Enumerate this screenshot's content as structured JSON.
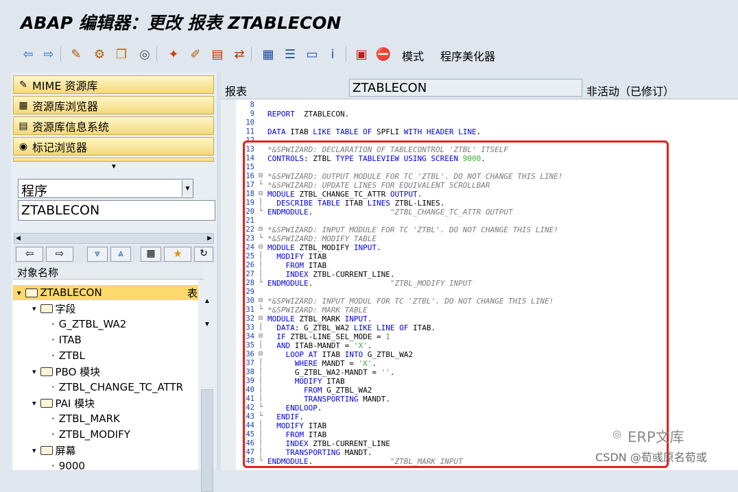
{
  "window": {
    "title": "ABAP 编辑器：更改 报表 ZTABLECON"
  },
  "toolbar": {
    "buttons": [
      {
        "name": "back-icon",
        "glyph": "⇦"
      },
      {
        "name": "forward-icon",
        "glyph": "⇨"
      },
      {
        "name": "display-change-icon",
        "glyph": "✎"
      },
      {
        "name": "active-inactive-icon",
        "glyph": "⚙"
      },
      {
        "name": "other-object-icon",
        "glyph": "❐"
      },
      {
        "name": "check-icon",
        "glyph": "◎"
      },
      {
        "name": "activate-icon",
        "glyph": "✦"
      },
      {
        "name": "test-icon",
        "glyph": "✐"
      },
      {
        "name": "where-used-icon",
        "glyph": "▤"
      },
      {
        "name": "navigate-icon",
        "glyph": "⇄"
      },
      {
        "name": "object-list-icon",
        "glyph": "▦"
      },
      {
        "name": "pretty-printer-icon",
        "glyph": "☰"
      },
      {
        "name": "display-object-list-icon",
        "glyph": "▭"
      },
      {
        "name": "info-icon",
        "glyph": "i"
      },
      {
        "name": "set-breakpoint-icon",
        "glyph": "▣"
      },
      {
        "name": "stop-breakpoint-icon",
        "glyph": "⛔"
      }
    ],
    "pattern_label": "模式",
    "pretty_printer_label": "程序美化器"
  },
  "nav": {
    "items": [
      {
        "label": "MIME 资源库",
        "icon": "mime-repo-icon",
        "glyph": "✎"
      },
      {
        "label": "资源库浏览器",
        "icon": "repo-browser-icon",
        "glyph": "▦"
      },
      {
        "label": "资源库信息系统",
        "icon": "repo-info-icon",
        "glyph": "▤"
      },
      {
        "label": "标记浏览器",
        "icon": "tag-browser-icon",
        "glyph": "◉"
      }
    ],
    "object_type": "程序",
    "object_name": "ZTABLECON"
  },
  "tree": {
    "header": "对象名称",
    "header_col2": "表",
    "rows": [
      {
        "label": "ZTABLECON",
        "level": 0,
        "type": "folder",
        "expanded": true,
        "selected": true,
        "extra": "表"
      },
      {
        "label": "字段",
        "level": 1,
        "type": "folder",
        "expanded": true
      },
      {
        "label": "G_ZTBL_WA2",
        "level": 2,
        "type": "leaf"
      },
      {
        "label": "ITAB",
        "level": 2,
        "type": "leaf"
      },
      {
        "label": "ZTBL",
        "level": 2,
        "type": "leaf"
      },
      {
        "label": "PBO 模块",
        "level": 1,
        "type": "folder",
        "expanded": true
      },
      {
        "label": "ZTBL_CHANGE_TC_ATTR",
        "level": 2,
        "type": "leaf"
      },
      {
        "label": "PAI 模块",
        "level": 1,
        "type": "folder",
        "expanded": true
      },
      {
        "label": "ZTBL_MARK",
        "level": 2,
        "type": "leaf"
      },
      {
        "label": "ZTBL_MODIFY",
        "level": 2,
        "type": "leaf"
      },
      {
        "label": "屏幕",
        "level": 1,
        "type": "folder",
        "expanded": true
      },
      {
        "label": "9000",
        "level": 2,
        "type": "leaf"
      }
    ]
  },
  "editor": {
    "type_label": "报表",
    "program_name": "ZTABLECON",
    "status": "非活动（已修订）",
    "lines": [
      {
        "n": "8",
        "fold": "",
        "seg": []
      },
      {
        "n": "9",
        "fold": "",
        "seg": [
          [
            "kw",
            "REPORT"
          ],
          [
            "",
            "  ZTABLECON."
          ]
        ]
      },
      {
        "n": "10",
        "fold": "",
        "seg": []
      },
      {
        "n": "11",
        "fold": "",
        "seg": [
          [
            "kw",
            "DATA"
          ],
          [
            "",
            " ITAB "
          ],
          [
            "kw",
            "LIKE TABLE OF"
          ],
          [
            "",
            " SPFLI "
          ],
          [
            "kw",
            "WITH HEADER LINE"
          ],
          [
            "",
            "."
          ]
        ]
      },
      {
        "n": "12",
        "fold": "",
        "seg": []
      },
      {
        "n": "13",
        "fold": "",
        "seg": [
          [
            "cm",
            "*&SPWIZARD: DECLARATION OF TABLECONTROL 'ZTBL' ITSELF"
          ]
        ]
      },
      {
        "n": "14",
        "fold": "",
        "seg": [
          [
            "kw",
            "CONTROLS"
          ],
          [
            "",
            ": ZTBL "
          ],
          [
            "kw",
            "TYPE TABLEVIEW USING SCREEN"
          ],
          [
            "",
            " "
          ],
          [
            "nm",
            "9000"
          ],
          [
            "",
            "."
          ]
        ]
      },
      {
        "n": "15",
        "fold": "",
        "seg": []
      },
      {
        "n": "16",
        "fold": "⊟",
        "seg": [
          [
            "cm",
            "*&SPWIZARD: OUTPUT MODULE FOR TC 'ZTBL'. DO NOT CHANGE THIS LINE!"
          ]
        ]
      },
      {
        "n": "17",
        "fold": "└",
        "seg": [
          [
            "cm",
            "*&SPWIZARD: UPDATE LINES FOR EQUIVALENT SCROLLBAR"
          ]
        ]
      },
      {
        "n": "18",
        "fold": "⊟",
        "seg": [
          [
            "kw",
            "MODULE"
          ],
          [
            "",
            " ZTBL_CHANGE_TC_ATTR "
          ],
          [
            "kw",
            "OUTPUT"
          ],
          [
            "",
            "."
          ]
        ]
      },
      {
        "n": "19",
        "fold": "│",
        "seg": [
          [
            "",
            "  "
          ],
          [
            "kw",
            "DESCRIBE TABLE"
          ],
          [
            "",
            " ITAB "
          ],
          [
            "kw",
            "LINES"
          ],
          [
            "",
            " ZTBL-LINES."
          ]
        ]
      },
      {
        "n": "20",
        "fold": "└",
        "seg": [
          [
            "kw",
            "ENDMODULE"
          ],
          [
            "",
            ".                 "
          ],
          [
            "cm",
            "\"ZTBL_CHANGE_TC_ATTR OUTPUT"
          ]
        ]
      },
      {
        "n": "21",
        "fold": "",
        "seg": []
      },
      {
        "n": "22",
        "fold": "⊟",
        "seg": [
          [
            "cm",
            "*&SPWIZARD: INPUT MODULE FOR TC 'ZTBL'. DO NOT CHANGE THIS LINE!"
          ]
        ]
      },
      {
        "n": "23",
        "fold": "└",
        "seg": [
          [
            "cm",
            "*&SPWIZARD: MODIFY TABLE"
          ]
        ]
      },
      {
        "n": "24",
        "fold": "⊟",
        "seg": [
          [
            "kw",
            "MODULE"
          ],
          [
            "",
            " ZTBL_MODIFY "
          ],
          [
            "kw",
            "INPUT"
          ],
          [
            "",
            "."
          ]
        ]
      },
      {
        "n": "25",
        "fold": "│",
        "seg": [
          [
            "",
            "  "
          ],
          [
            "kw",
            "MODIFY"
          ],
          [
            "",
            " ITAB"
          ]
        ]
      },
      {
        "n": "26",
        "fold": "│",
        "seg": [
          [
            "",
            "    "
          ],
          [
            "kw",
            "FROM"
          ],
          [
            "",
            " ITAB"
          ]
        ]
      },
      {
        "n": "27",
        "fold": "│",
        "seg": [
          [
            "",
            "    "
          ],
          [
            "kw",
            "INDEX"
          ],
          [
            "",
            " ZTBL-CURRENT_LINE."
          ]
        ]
      },
      {
        "n": "28",
        "fold": "└",
        "seg": [
          [
            "kw",
            "ENDMODULE"
          ],
          [
            "",
            ".                 "
          ],
          [
            "cm",
            "\"ZTBL_MODIFY INPUT"
          ]
        ]
      },
      {
        "n": "29",
        "fold": "",
        "seg": []
      },
      {
        "n": "30",
        "fold": "⊟",
        "seg": [
          [
            "cm",
            "*&SPWIZARD: INPUT MODUL FOR TC 'ZTBL'. DO NOT CHANGE THIS LINE!"
          ]
        ]
      },
      {
        "n": "31",
        "fold": "└",
        "seg": [
          [
            "cm",
            "*&SPWIZARD: MARK TABLE"
          ]
        ]
      },
      {
        "n": "32",
        "fold": "⊟",
        "seg": [
          [
            "kw",
            "MODULE"
          ],
          [
            "",
            " ZTBL_MARK "
          ],
          [
            "kw",
            "INPUT"
          ],
          [
            "",
            "."
          ]
        ]
      },
      {
        "n": "33",
        "fold": "│",
        "seg": [
          [
            "",
            "  "
          ],
          [
            "kw",
            "DATA"
          ],
          [
            "",
            ": G_ZTBL_WA2 "
          ],
          [
            "kw",
            "LIKE LINE OF"
          ],
          [
            "",
            " ITAB."
          ]
        ]
      },
      {
        "n": "34",
        "fold": "⊟",
        "seg": [
          [
            "",
            "  "
          ],
          [
            "kw",
            "IF"
          ],
          [
            "",
            " ZTBL-LINE_SEL_MODE = "
          ],
          [
            "nm",
            "1"
          ]
        ]
      },
      {
        "n": "35",
        "fold": "│",
        "seg": [
          [
            "",
            "  "
          ],
          [
            "kw",
            "AND"
          ],
          [
            "",
            " ITAB-MANDT = "
          ],
          [
            "st",
            "'X'"
          ],
          [
            "",
            "."
          ]
        ]
      },
      {
        "n": "36",
        "fold": "⊟",
        "seg": [
          [
            "",
            "    "
          ],
          [
            "kw",
            "LOOP AT"
          ],
          [
            "",
            " ITAB "
          ],
          [
            "kw",
            "INTO"
          ],
          [
            "",
            " G_ZTBL_WA2"
          ]
        ]
      },
      {
        "n": "37",
        "fold": "│",
        "seg": [
          [
            "",
            "      "
          ],
          [
            "kw",
            "WHERE"
          ],
          [
            "",
            " MANDT = "
          ],
          [
            "st",
            "'X'"
          ],
          [
            "",
            "."
          ]
        ]
      },
      {
        "n": "38",
        "fold": "│",
        "seg": [
          [
            "",
            "      G_ZTBL_WA2-MANDT = "
          ],
          [
            "st",
            "''"
          ],
          [
            "",
            "."
          ]
        ]
      },
      {
        "n": "39",
        "fold": "│",
        "seg": [
          [
            "",
            "      "
          ],
          [
            "kw",
            "MODIFY"
          ],
          [
            "",
            " ITAB"
          ]
        ]
      },
      {
        "n": "40",
        "fold": "│",
        "seg": [
          [
            "",
            "        "
          ],
          [
            "kw",
            "FROM"
          ],
          [
            "",
            " G_ZTBL_WA2"
          ]
        ]
      },
      {
        "n": "41",
        "fold": "│",
        "seg": [
          [
            "",
            "        "
          ],
          [
            "kw",
            "TRANSPORTING"
          ],
          [
            "",
            " MANDT."
          ]
        ]
      },
      {
        "n": "42",
        "fold": "└",
        "seg": [
          [
            "",
            "    "
          ],
          [
            "kw",
            "ENDLOOP"
          ],
          [
            "",
            "."
          ]
        ]
      },
      {
        "n": "43",
        "fold": "└",
        "seg": [
          [
            "",
            "  "
          ],
          [
            "kw",
            "ENDIF"
          ],
          [
            "",
            "."
          ]
        ]
      },
      {
        "n": "44",
        "fold": "│",
        "seg": [
          [
            "",
            "  "
          ],
          [
            "kw",
            "MODIFY"
          ],
          [
            "",
            " ITAB"
          ]
        ]
      },
      {
        "n": "45",
        "fold": "│",
        "seg": [
          [
            "",
            "    "
          ],
          [
            "kw",
            "FROM"
          ],
          [
            "",
            " ITAB"
          ]
        ]
      },
      {
        "n": "46",
        "fold": "│",
        "seg": [
          [
            "",
            "    "
          ],
          [
            "kw",
            "INDEX"
          ],
          [
            "",
            " ZTBL-CURRENT_LINE"
          ]
        ]
      },
      {
        "n": "47",
        "fold": "│",
        "seg": [
          [
            "",
            "    "
          ],
          [
            "kw",
            "TRANSPORTING"
          ],
          [
            "",
            " MANDT."
          ]
        ]
      },
      {
        "n": "48",
        "fold": "└",
        "seg": [
          [
            "kw",
            "ENDMODULE"
          ],
          [
            "",
            ".                 "
          ],
          [
            "cm",
            "\"ZTBL_MARK INPUT"
          ]
        ]
      }
    ]
  },
  "watermark": {
    "brand": "ERP文库",
    "credit": "CSDN @荀彧原名荀或"
  },
  "colors": {
    "highlight_box": "#e5201e",
    "keyword": "#0000e0",
    "comment": "#7a7a7a",
    "literal": "#3aa63a",
    "selection": "#fbd96a"
  }
}
